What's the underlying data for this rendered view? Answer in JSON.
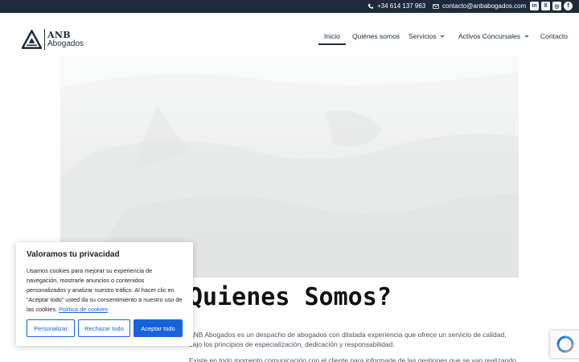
{
  "topbar": {
    "phone": "+34 614 137 963",
    "email": "contacto@anbabogados.com",
    "socials": [
      {
        "icon": "linkedin-icon",
        "glyph": "in"
      },
      {
        "icon": "x-twitter-icon",
        "glyph": "X"
      },
      {
        "icon": "instagram-icon",
        "glyph": "◎"
      },
      {
        "icon": "facebook-icon",
        "glyph": "f"
      }
    ]
  },
  "logo": {
    "line1": "ANB",
    "line2": "Abogados"
  },
  "nav": {
    "items": [
      {
        "label": "Inicio",
        "active": true
      },
      {
        "label": "Quiénes somos"
      },
      {
        "label": "Servicios",
        "dropdown": true
      },
      {
        "label": "Activos Concursales",
        "dropdown": true
      },
      {
        "label": "Contacto"
      }
    ]
  },
  "main": {
    "title": "Quienes Somos?",
    "paragraph1": "ANB Abogados es un despacho de abogados con dilatada experiencia que ofrece un servicio de calidad, bajo los principios de especialización, dedicación y responsabilidad.",
    "paragraph2": "Existe en todo momento comunicación con el cliente para informarle de las gestiones que se van realizando para"
  },
  "cookie": {
    "title": "Valoramos tu privacidad",
    "text": "Usamos cookies para mejorar su experiencia de navegación, mostrarle anuncios o contenidos personalizados y analizar nuestro tráfico. Al hacer clic en “Aceptar todo” usted da su consentimiento a nuestro uso de las cookies.",
    "policy_link": "Política de cookies",
    "customize": "Personalizar",
    "reject": "Rechazar todo",
    "accept": "Aceptar todo"
  },
  "colors": {
    "topbar": "#1d2a3b",
    "accent": "#1863dc",
    "text": "#1d2a3b"
  }
}
